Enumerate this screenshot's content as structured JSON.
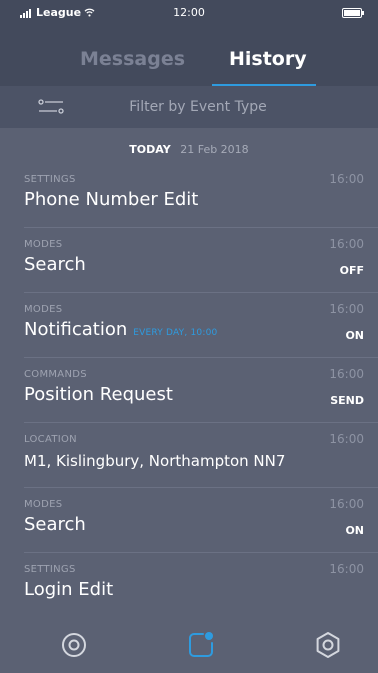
{
  "status": {
    "carrier": "League",
    "time": "12:00"
  },
  "tabs": [
    {
      "label": "Messages",
      "active": false
    },
    {
      "label": "History",
      "active": true
    }
  ],
  "filter": {
    "placeholder": "Filter by Event Type",
    "icon": "filter-sliders-icon"
  },
  "day": {
    "label": "TODAY",
    "date": "21 Feb 2018"
  },
  "events": [
    {
      "category": "SETTINGS",
      "title": "Phone Number Edit",
      "time": "16:00"
    },
    {
      "category": "MODES",
      "title": "Search",
      "time": "16:00",
      "action": "OFF"
    },
    {
      "category": "MODES",
      "title": "Notification",
      "subtitle": "EVERY DAY, 10:00",
      "time": "16:00",
      "action": "ON"
    },
    {
      "category": "COMMANDS",
      "title": "Position Request",
      "time": "16:00",
      "action": "SEND"
    },
    {
      "category": "LOCATION",
      "title": "M1, Kislingbury, Northampton NN7",
      "time": "16:00"
    },
    {
      "category": "MODES",
      "title": "Search",
      "time": "16:00",
      "action": "ON"
    },
    {
      "category": "SETTINGS",
      "title": "Login Edit",
      "time": "16:00"
    }
  ],
  "nav": [
    {
      "icon": "target-icon",
      "active": false
    },
    {
      "icon": "notification-square-icon",
      "active": true
    },
    {
      "icon": "hexagon-settings-icon",
      "active": false
    }
  ],
  "colors": {
    "accent": "#2e9bdf",
    "background": "#5b6173",
    "header": "#434a5c"
  }
}
